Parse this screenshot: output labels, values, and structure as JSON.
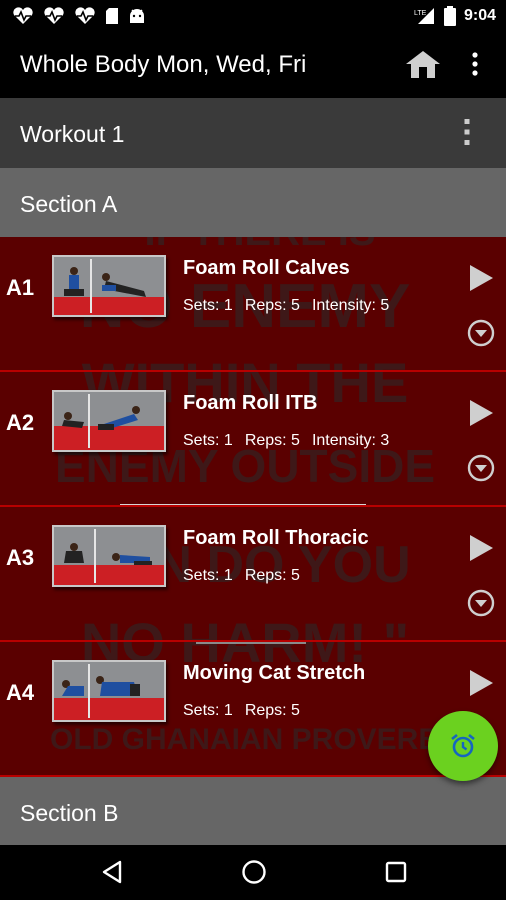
{
  "status_bar": {
    "time": "9:04",
    "network": "LTE",
    "icons": [
      "heartbeat-icon",
      "heartbeat-icon",
      "heartbeat-icon",
      "sd-card-icon",
      "android-icon",
      "signal-icon",
      "battery-icon"
    ]
  },
  "app_bar": {
    "title": "Whole Body Mon, Wed, Fri",
    "icons": [
      "home-icon",
      "overflow-menu-icon"
    ]
  },
  "workout": {
    "label": "Workout 1"
  },
  "sections": [
    {
      "label": "Section A"
    },
    {
      "label": "Section B"
    }
  ],
  "exercises": [
    {
      "id": "A1",
      "name": "Foam Roll Calves",
      "sets": "Sets: 1",
      "reps": "Reps: 5",
      "intensity": "Intensity: 5"
    },
    {
      "id": "A2",
      "name": "Foam Roll ITB",
      "sets": "Sets: 1",
      "reps": "Reps: 5",
      "intensity": "Intensity: 3"
    },
    {
      "id": "A3",
      "name": "Foam Roll Thoracic",
      "sets": "Sets: 1",
      "reps": "Reps: 5"
    },
    {
      "id": "A4",
      "name": "Moving Cat Stretch",
      "sets": "Sets: 1",
      "reps": "Reps: 5"
    }
  ],
  "background_quote": {
    "lines": [
      "\" IF THERE IS",
      "NO ENEMY",
      "WITHIN THE",
      "ENEMY OUTSIDE",
      "CAN DO YOU",
      "NO HARM! \"",
      "OLD GHANAIAN PROVERB"
    ]
  },
  "fab": {
    "icon": "alarm-clock-icon"
  },
  "nav_bar": {
    "icons": [
      "back-icon",
      "home-circle-icon",
      "recents-icon"
    ]
  },
  "colors": {
    "list_background": "#5a0000",
    "row_divider": "#b80000",
    "section_header": "#666666",
    "workout_header": "#3a3a3a",
    "fab": "#6bd11f",
    "fab_icon": "#1565c0"
  }
}
